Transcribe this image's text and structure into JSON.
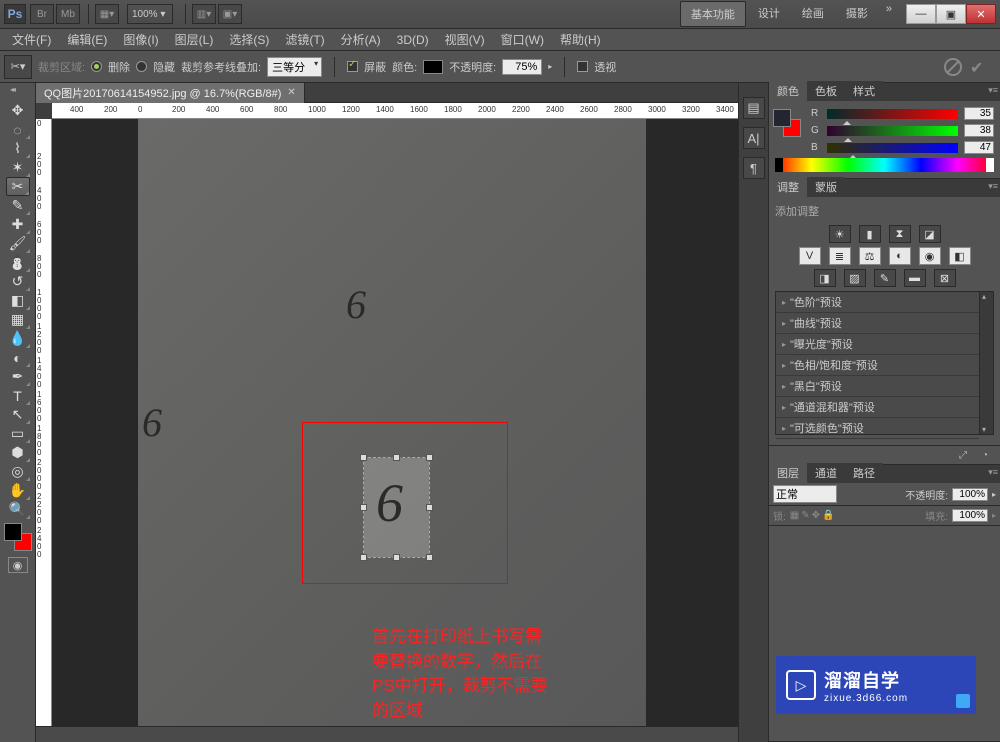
{
  "app": {
    "logo": "Ps",
    "zoom": "100%"
  },
  "workspace": {
    "tabs": [
      "基本功能",
      "设计",
      "绘画",
      "摄影"
    ],
    "active": 0,
    "more": "»"
  },
  "menu": [
    "文件(F)",
    "编辑(E)",
    "图像(I)",
    "图层(L)",
    "选择(S)",
    "滤镜(T)",
    "分析(A)",
    "3D(D)",
    "视图(V)",
    "窗口(W)",
    "帮助(H)"
  ],
  "options": {
    "crop_area_label": "裁剪区域:",
    "delete_label": "删除",
    "hide_label": "隐藏",
    "guides_label": "裁剪参考线叠加:",
    "guides_value": "三等分",
    "shield_label": "屏蔽",
    "color_label": "颜色:",
    "opacity_label": "不透明度:",
    "opacity_value": "75%",
    "perspective_label": "透视"
  },
  "document": {
    "tab_title": "QQ图片20170614154952.jpg @ 16.7%(RGB/8#)",
    "ruler_h": [
      "400",
      "200",
      "0",
      "200",
      "400",
      "600",
      "800",
      "1000",
      "1200",
      "1400",
      "1600",
      "1800",
      "2000",
      "2200",
      "2400",
      "2600",
      "2800",
      "3000",
      "3200",
      "3400"
    ],
    "ruler_v": [
      "0",
      "2 0 0",
      "4 0 0",
      "6 0 0",
      "8 0 0",
      "1 0 0 0",
      "1 2 0 0",
      "1 4 0 0",
      "1 6 0 0",
      "1 8 0 0",
      "2 0 0 0",
      "2 2 0 0",
      "2 4 0 0"
    ],
    "annotation_lines": [
      "首先在打印纸上书写需",
      "要替换的数字，然后在",
      "PS中打开，裁剪不需要",
      "的区域"
    ]
  },
  "color": {
    "tabs": [
      "颜色",
      "色板",
      "样式"
    ],
    "r": "35",
    "g": "38",
    "b": "47"
  },
  "adjustments": {
    "tabs": [
      "调整",
      "蒙版"
    ],
    "add_label": "添加调整",
    "presets": [
      "\"色阶\"预设",
      "\"曲线\"预设",
      "\"曝光度\"预设",
      "\"色相/饱和度\"预设",
      "\"黑白\"预设",
      "\"通道混和器\"预设",
      "\"可选颜色\"预设"
    ]
  },
  "layers": {
    "tabs": [
      "图层",
      "通道",
      "路径"
    ],
    "blend": "正常",
    "opacity_label": "不透明度:",
    "opacity_value": "100%",
    "lock_label": "锁:",
    "fill_label": "填充:",
    "fill_value": "100%"
  },
  "watermark": {
    "main": "溜溜自学",
    "sub": "zixue.3d66.com"
  }
}
